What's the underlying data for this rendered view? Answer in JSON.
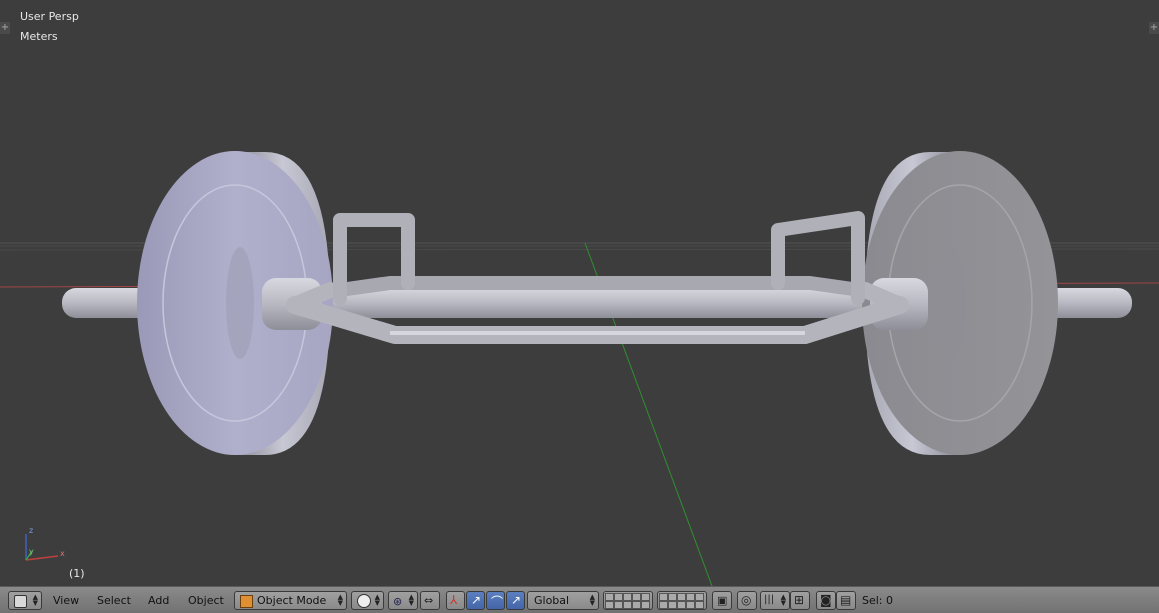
{
  "viewport": {
    "view_name": "User Persp",
    "units": "Meters",
    "frame": "(1)",
    "axis_labels": {
      "x": "x",
      "y": "y",
      "z": "z"
    }
  },
  "header": {
    "menus": [
      "View",
      "Select",
      "Add",
      "Object"
    ],
    "mode": "Object Mode",
    "orientation": "Global",
    "selection": "Sel: 0",
    "icons": [
      "editor-type-icon",
      "shading-solid-icon",
      "pivot-icon",
      "manipulator-icon",
      "translate-icon",
      "rotate-icon",
      "scale-icon",
      "layers-icon",
      "lock-icon",
      "proportional-edit-icon",
      "snap-icon",
      "snap-target-icon",
      "render-icon",
      "clapper-icon"
    ]
  },
  "colors": {
    "viewport_bg": "#3d3d3d",
    "header_bg": "#7e7e7e",
    "active_button": "#5b7fbf",
    "grid_red_axis": "#b04040",
    "grid_green_axis": "#3e9a3e"
  }
}
